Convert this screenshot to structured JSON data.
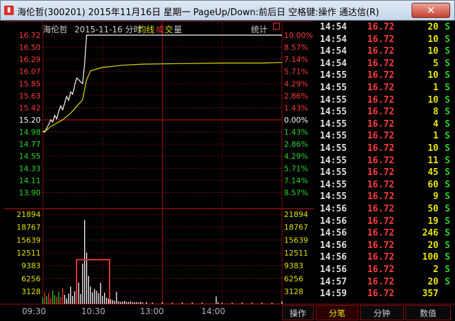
{
  "window": {
    "title": "海伦哲(300201) 2015年11月16日 星期一 PageUp/Down:前后日 空格键:操作 通达信(R)",
    "close_label": "✕"
  },
  "chart": {
    "header": {
      "stock": "海伦哲",
      "date_label": "2015-11-16 分时",
      "legend_avg": "均线",
      "legend_deal_1": "成",
      "legend_deal_2": "交",
      "legend_vol": "量",
      "stats": "统计"
    },
    "price_labels": [
      "16.72",
      "16.50",
      "16.29",
      "16.07",
      "15.85",
      "15.63",
      "15.42",
      "15.20",
      "14.98",
      "14.77",
      "14.55",
      "14.33",
      "14.11",
      "13.90"
    ],
    "pct_labels": [
      "10.00%",
      "8.57%",
      "7.14%",
      "5.71%",
      "4.29%",
      "2.86%",
      "1.43%",
      "0.00%",
      "1.43%",
      "2.86%",
      "4.29%",
      "5.71%",
      "7.14%",
      "8.57%"
    ],
    "vol_labels": [
      "21894",
      "18767",
      "15639",
      "12511",
      "9383",
      "6256",
      "3128"
    ],
    "time_labels": [
      "09:30",
      "10:30",
      "13:00",
      "14:00"
    ],
    "colors": {
      "up": "#ff3b3b",
      "down": "#28d628",
      "flat": "#ffffff",
      "price_line": "#ffffff",
      "avg_line": "#e0e000",
      "grid": "#8a0d0d",
      "highlight_box": "#e03030"
    }
  },
  "chart_data": {
    "type": "line",
    "title": "2015-11-16 分时",
    "x_ticks": [
      "09:30",
      "10:30",
      "13:00",
      "14:00"
    ],
    "ylim": [
      13.68,
      16.72
    ],
    "prev_close": 15.2,
    "series": [
      {
        "name": "",
        "x": [
          0,
          2,
          4,
          6,
          8,
          10,
          12,
          14,
          16,
          18,
          20,
          22,
          24,
          26,
          28,
          30,
          32,
          34,
          36,
          38,
          40,
          42,
          44,
          46,
          48,
          50,
          52,
          240
        ],
        "values": [
          15.0,
          14.98,
          15.05,
          15.12,
          15.2,
          15.16,
          15.28,
          15.22,
          15.35,
          15.45,
          15.38,
          15.5,
          15.62,
          15.55,
          15.7,
          15.66,
          15.82,
          15.95,
          15.92,
          15.88,
          15.85,
          16.2,
          16.72,
          16.72,
          16.72,
          16.72,
          16.72,
          16.72
        ]
      },
      {
        "name": "均线",
        "x": [
          0,
          4,
          8,
          12,
          16,
          20,
          24,
          28,
          32,
          36,
          40,
          44,
          48,
          60,
          80,
          100,
          140,
          180,
          220,
          240
        ],
        "values": [
          14.98,
          15.02,
          15.08,
          15.12,
          15.16,
          15.2,
          15.26,
          15.32,
          15.4,
          15.48,
          15.56,
          15.92,
          16.08,
          16.14,
          16.18,
          16.2,
          16.21,
          16.22,
          16.22,
          16.23
        ]
      }
    ],
    "volume": {
      "ylim": [
        0,
        21894
      ],
      "x": [
        0,
        2,
        4,
        6,
        8,
        10,
        12,
        14,
        16,
        18,
        20,
        22,
        24,
        26,
        28,
        30,
        32,
        34,
        36,
        38,
        40,
        42,
        44,
        46,
        48,
        50,
        52,
        54,
        56,
        58,
        60,
        62,
        64,
        66,
        68,
        70,
        72,
        74,
        76,
        78,
        80,
        82,
        84,
        86,
        88,
        90,
        92,
        94,
        96,
        98,
        100,
        104,
        110,
        120,
        130,
        140,
        150,
        160,
        174,
        176,
        180,
        190,
        200,
        210,
        220,
        230,
        240
      ],
      "values": [
        1500,
        2800,
        1900,
        2600,
        1400,
        3200,
        2100,
        1700,
        2900,
        1600,
        3800,
        2200,
        1300,
        2500,
        4200,
        1900,
        3000,
        1600,
        5200,
        2400,
        9800,
        20500,
        12500,
        6800,
        4200,
        2800,
        3600,
        3200,
        2600,
        5100,
        1900,
        2700,
        1500,
        1200,
        1100,
        900,
        700,
        2900,
        600,
        500,
        500,
        700,
        450,
        400,
        600,
        380,
        350,
        420,
        300,
        500,
        350,
        400,
        300,
        380,
        260,
        300,
        320,
        280,
        1800,
        400,
        260,
        240,
        300,
        260,
        280,
        240,
        600
      ],
      "colors_cycle": [
        "down",
        "up",
        "down",
        "up",
        "up",
        "down",
        "down",
        "up",
        "down",
        "up",
        "up",
        "flat",
        "flat",
        "flat",
        "flat",
        "flat",
        "flat",
        "flat",
        "flat",
        "flat",
        "flat",
        "flat",
        "flat",
        "flat",
        "flat",
        "flat",
        "flat",
        "flat",
        "flat",
        "flat",
        "flat",
        "flat",
        "flat",
        "flat",
        "flat",
        "flat",
        "flat",
        "flat",
        "flat",
        "flat",
        "flat",
        "flat",
        "flat",
        "flat",
        "flat",
        "flat",
        "flat",
        "flat",
        "flat",
        "flat",
        "flat",
        "flat",
        "flat",
        "flat",
        "flat",
        "flat",
        "flat",
        "flat",
        "flat",
        "flat",
        "flat",
        "flat",
        "flat",
        "flat",
        "flat",
        "flat",
        "flat"
      ]
    }
  },
  "ticks": {
    "rows": [
      {
        "time": "14:54",
        "price": "16.72",
        "vol": "20",
        "dir": "S"
      },
      {
        "time": "14:54",
        "price": "16.72",
        "vol": "10",
        "dir": "S"
      },
      {
        "time": "14:54",
        "price": "16.72",
        "vol": "10",
        "dir": "S"
      },
      {
        "time": "14:54",
        "price": "16.72",
        "vol": "5",
        "dir": "S"
      },
      {
        "time": "14:55",
        "price": "16.72",
        "vol": "10",
        "dir": "S"
      },
      {
        "time": "14:55",
        "price": "16.72",
        "vol": "1",
        "dir": "S"
      },
      {
        "time": "14:55",
        "price": "16.72",
        "vol": "10",
        "dir": "S"
      },
      {
        "time": "14:55",
        "price": "16.72",
        "vol": "8",
        "dir": "S"
      },
      {
        "time": "14:55",
        "price": "16.72",
        "vol": "4",
        "dir": "S"
      },
      {
        "time": "14:55",
        "price": "16.72",
        "vol": "1",
        "dir": "S"
      },
      {
        "time": "14:55",
        "price": "16.72",
        "vol": "10",
        "dir": "S"
      },
      {
        "time": "14:55",
        "price": "16.72",
        "vol": "11",
        "dir": "S"
      },
      {
        "time": "14:55",
        "price": "16.72",
        "vol": "45",
        "dir": "S"
      },
      {
        "time": "14:55",
        "price": "16.72",
        "vol": "60",
        "dir": "S"
      },
      {
        "time": "14:55",
        "price": "16.72",
        "vol": "9",
        "dir": "S"
      },
      {
        "time": "14:56",
        "price": "16.72",
        "vol": "50",
        "dir": "S"
      },
      {
        "time": "14:56",
        "price": "16.72",
        "vol": "19",
        "dir": "S"
      },
      {
        "time": "14:56",
        "price": "16.72",
        "vol": "246",
        "dir": "S"
      },
      {
        "time": "14:56",
        "price": "16.72",
        "vol": "20",
        "dir": "S"
      },
      {
        "time": "14:56",
        "price": "16.72",
        "vol": "100",
        "dir": "S"
      },
      {
        "time": "14:56",
        "price": "16.72",
        "vol": "2",
        "dir": "S"
      },
      {
        "time": "14:57",
        "price": "16.72",
        "vol": "20",
        "dir": "S"
      },
      {
        "time": "14:59",
        "price": "16.72",
        "vol": "357",
        "dir": ""
      }
    ]
  },
  "bottom": {
    "tabs": [
      {
        "label": "操作"
      },
      {
        "label": "分笔"
      },
      {
        "label": "分钟"
      },
      {
        "label": "数值"
      }
    ]
  }
}
